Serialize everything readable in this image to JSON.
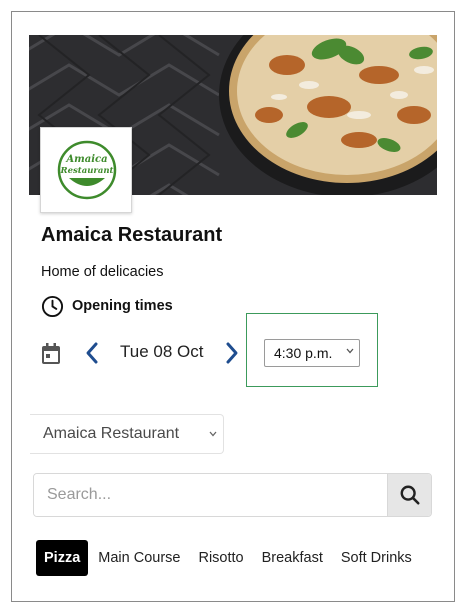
{
  "restaurant": {
    "name": "Amaica Restaurant",
    "tagline": "Home of delicacies",
    "logo_line1": "Amaica",
    "logo_line2": "Restaurant"
  },
  "schedule": {
    "opening_label": "Opening times",
    "date": "Tue 08 Oct",
    "time": "4:30 p.m."
  },
  "restaurant_selector": {
    "value": "Amaica Restaurant"
  },
  "search": {
    "placeholder": "Search..."
  },
  "categories": [
    "Pizza",
    "Main Course",
    "Risotto",
    "Breakfast",
    "Soft Drinks"
  ],
  "active_category": "Pizza",
  "icons": {
    "clock": "clock-icon",
    "calendar": "calendar-icon",
    "prev": "chevron-left-icon",
    "next": "chevron-right-icon",
    "search": "search-icon",
    "dropdown": "chevron-down-icon"
  },
  "colors": {
    "brand_green": "#3e8b2c",
    "nav_blue": "#1f4d8f",
    "highlight_border": "#3c9a5b",
    "active_tab": "#000000"
  }
}
